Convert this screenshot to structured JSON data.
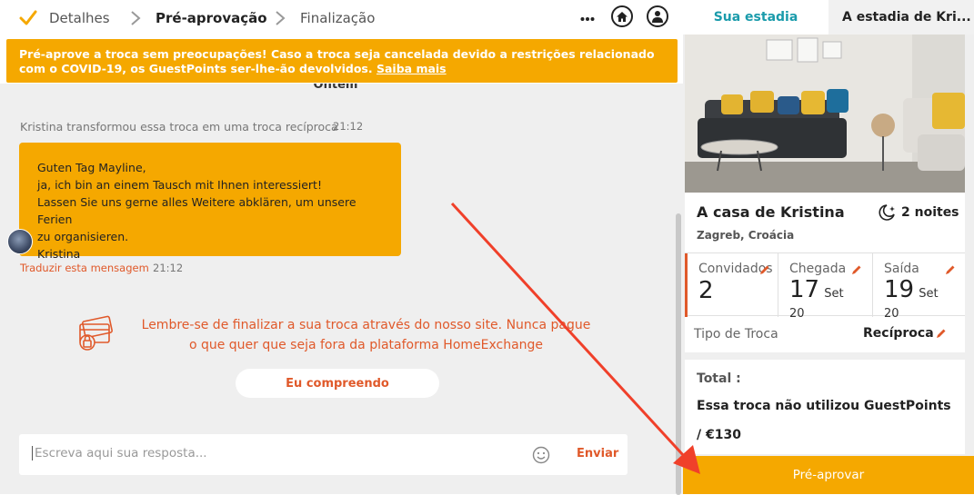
{
  "steps": [
    {
      "label": "Detalhes",
      "state": "done"
    },
    {
      "label": "Pré-aprovação",
      "state": "active"
    },
    {
      "label": "Finalização",
      "state": "upcoming"
    }
  ],
  "header_icons": [
    "more-icon",
    "home-icon",
    "user-icon"
  ],
  "banner": {
    "text": "Pré-aprove a troca sem preocupações! Caso a troca seja cancelada devido a restrições relacionado com o COVID-19, os GuestPoints ser-lhe-ão devolvidos. ",
    "link": "Saiba mais"
  },
  "chat": {
    "day_separator": "Ontem",
    "system_message": "Kristina transformou essa troca em uma troca recíproca",
    "system_time": "21:12",
    "message_lines": [
      "Guten Tag Mayline,",
      "ja, ich bin an einem Tausch mit Ihnen interessiert!",
      "Lassen Sie uns gerne alles Weitere abklären, um unsere Ferien",
      "zu organisieren.",
      "Kristina"
    ],
    "translate_label": "Traduzir esta mensagem",
    "message_time": "21:12",
    "reminder": "Lembre-se de finalizar a sua troca através do nosso site. Nunca pague o que quer que seja fora da plataforma HomeExchange",
    "understand_label": "Eu compreendo"
  },
  "composer": {
    "placeholder": "Escreva aqui sua resposta...",
    "send_label": "Enviar"
  },
  "tabs": [
    {
      "label": "Sua estadia",
      "active": true
    },
    {
      "label": "A estadia de Kri..."
    }
  ],
  "stay": {
    "home_title": "A casa de Kristina",
    "nights": "2 noites",
    "location": "Zagreb, Croácia",
    "guests_label": "Convidados",
    "guests_value": "2",
    "arrival_label": "Chegada",
    "arrival_day": "17",
    "arrival_month": "Set 20",
    "departure_label": "Saída",
    "departure_day": "19",
    "departure_month": "Set 20",
    "type_label": "Tipo de Troca",
    "type_value": "Recíproca",
    "total_label": "Total :",
    "total_text": "Essa troca não utilizou GuestPoints / €130",
    "preapprove_label": "Pré-aprovar"
  },
  "colors": {
    "accent": "#f5a800",
    "teal": "#1a9bab",
    "warning_text": "#e0592a",
    "annotation_arrow": "#f0402a"
  }
}
